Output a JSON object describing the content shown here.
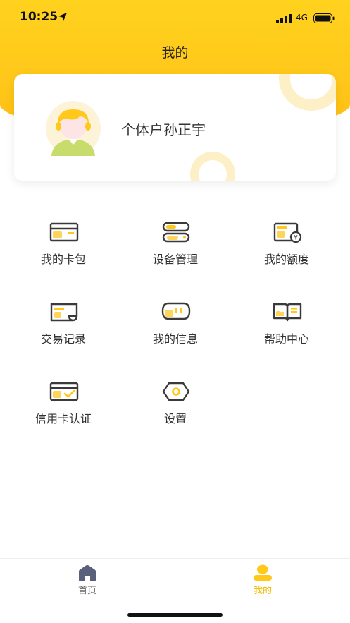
{
  "status_bar": {
    "time": "10:25",
    "network": "4G",
    "icons": [
      "location-arrow-icon",
      "signal-icon",
      "battery-icon"
    ]
  },
  "header": {
    "title": "我的"
  },
  "profile": {
    "name": "个体户孙正宇",
    "avatar_icon": "user-avatar-icon"
  },
  "menu": {
    "items": [
      {
        "label": "我的卡包",
        "icon": "card-wallet-icon"
      },
      {
        "label": "设备管理",
        "icon": "device-manage-icon"
      },
      {
        "label": "我的额度",
        "icon": "credit-limit-icon"
      },
      {
        "label": "交易记录",
        "icon": "transaction-record-icon"
      },
      {
        "label": "我的信息",
        "icon": "message-icon"
      },
      {
        "label": "帮助中心",
        "icon": "help-book-icon"
      },
      {
        "label": "信用卡认证",
        "icon": "credit-card-verify-icon"
      },
      {
        "label": "设置",
        "icon": "settings-icon"
      }
    ]
  },
  "tab_bar": {
    "tabs": [
      {
        "label": "首页",
        "icon": "home-icon",
        "active": false
      },
      {
        "label": "我的",
        "icon": "person-icon",
        "active": true
      }
    ]
  },
  "colors": {
    "accent": "#ffc81a",
    "active_tab": "#f5b800",
    "icon_dark": "#3a3a3a"
  }
}
